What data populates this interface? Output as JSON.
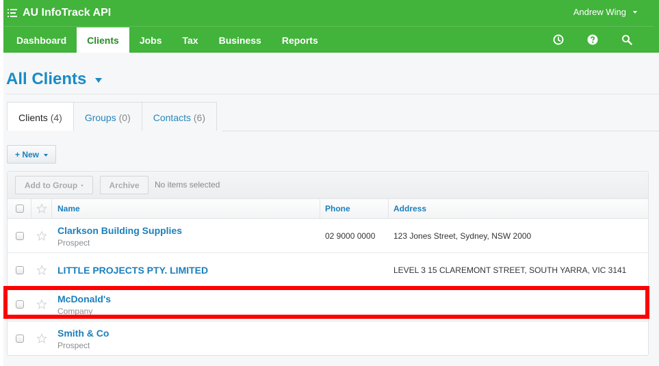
{
  "app": {
    "title": "AU InfoTrack API",
    "user_name": "Andrew Wing"
  },
  "nav": {
    "items": [
      {
        "label": "Dashboard",
        "active": false
      },
      {
        "label": "Clients",
        "active": true
      },
      {
        "label": "Jobs",
        "active": false
      },
      {
        "label": "Tax",
        "active": false
      },
      {
        "label": "Business",
        "active": false
      },
      {
        "label": "Reports",
        "active": false
      }
    ],
    "tools": [
      "clock-icon",
      "help-icon",
      "search-icon"
    ]
  },
  "page": {
    "title": "All Clients"
  },
  "tabs": [
    {
      "label": "Clients",
      "count": "(4)",
      "active": true
    },
    {
      "label": "Groups",
      "count": "(0)",
      "active": false
    },
    {
      "label": "Contacts",
      "count": "(6)",
      "active": false
    }
  ],
  "actions": {
    "new_label": "+ New",
    "add_to_group_label": "Add to Group",
    "archive_label": "Archive",
    "selection_status": "No items selected"
  },
  "table": {
    "columns": {
      "name": "Name",
      "phone": "Phone",
      "address": "Address"
    },
    "rows": [
      {
        "name": "Clarkson Building Supplies",
        "type": "Prospect",
        "phone": "02 9000 0000",
        "address": "123 Jones Street, Sydney, NSW 2000",
        "highlighted": false
      },
      {
        "name": "LITTLE PROJECTS PTY. LIMITED",
        "type": "",
        "phone": "",
        "address": "LEVEL 3 15 CLAREMONT STREET, SOUTH YARRA, VIC 3141",
        "highlighted": false
      },
      {
        "name": "McDonald's",
        "type": "Company",
        "phone": "",
        "address": "",
        "highlighted": true
      },
      {
        "name": "Smith & Co",
        "type": "Prospect",
        "phone": "",
        "address": "",
        "highlighted": false
      }
    ]
  },
  "colors": {
    "brand_green": "#42b33b",
    "link_blue": "#1a7fbc",
    "highlight_red": "#ff0000"
  }
}
